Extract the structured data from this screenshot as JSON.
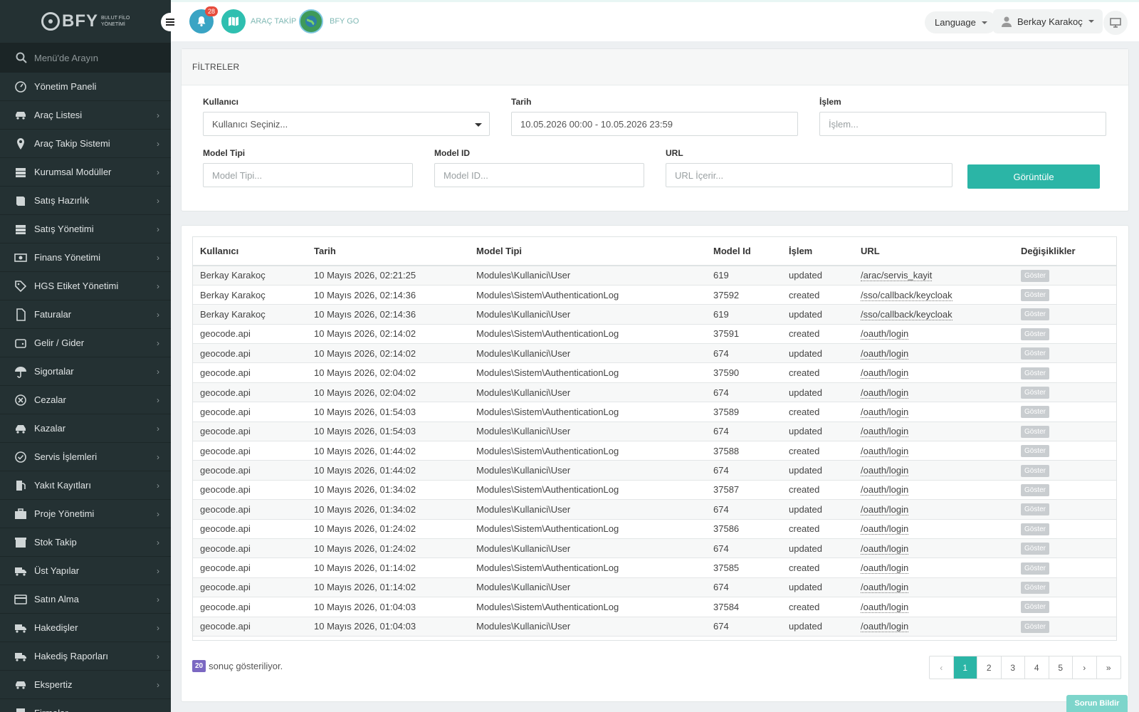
{
  "brand": {
    "name": "BFY",
    "sub1": "BULUT FİLO",
    "sub2": "YÖNETİMİ"
  },
  "sidebar": {
    "search_placeholder": "Menü'de Arayın",
    "items": [
      {
        "label": "Yönetim Paneli",
        "icon": "dashboard-icon",
        "chevron": false
      },
      {
        "label": "Araç Listesi",
        "icon": "car-icon",
        "chevron": true
      },
      {
        "label": "Araç Takip Sistemi",
        "icon": "map-pin-icon",
        "chevron": true
      },
      {
        "label": "Kurumsal Modüller",
        "icon": "server-icon",
        "chevron": true
      },
      {
        "label": "Satış Hazırlık",
        "icon": "book-icon",
        "chevron": true
      },
      {
        "label": "Satış Yönetimi",
        "icon": "server-icon",
        "chevron": true
      },
      {
        "label": "Finans Yönetimi",
        "icon": "money-icon",
        "chevron": true
      },
      {
        "label": "HGS Etiket Yönetimi",
        "icon": "tag-icon",
        "chevron": true
      },
      {
        "label": "Faturalar",
        "icon": "file-icon",
        "chevron": true
      },
      {
        "label": "Gelir / Gider",
        "icon": "wallet-icon",
        "chevron": true
      },
      {
        "label": "Sigortalar",
        "icon": "umbrella-icon",
        "chevron": true
      },
      {
        "label": "Cezalar",
        "icon": "cancel-circle-icon",
        "chevron": true
      },
      {
        "label": "Kazalar",
        "icon": "car-crash-icon",
        "chevron": true
      },
      {
        "label": "Servis İşlemleri",
        "icon": "check-circle-icon",
        "chevron": true
      },
      {
        "label": "Yakıt Kayıtları",
        "icon": "fuel-icon",
        "chevron": true
      },
      {
        "label": "Proje Yönetimi",
        "icon": "briefcase-icon",
        "chevron": true
      },
      {
        "label": "Stok Takip",
        "icon": "box-icon",
        "chevron": true
      },
      {
        "label": "Üst Yapılar",
        "icon": "truck-icon",
        "chevron": true
      },
      {
        "label": "Satın Alma",
        "icon": "credit-card-icon",
        "chevron": true
      },
      {
        "label": "Hakedişler",
        "icon": "truck-icon",
        "chevron": true
      },
      {
        "label": "Hakediş Raporları",
        "icon": "truck-icon",
        "chevron": true
      },
      {
        "label": "Ekspertiz",
        "icon": "car-icon",
        "chevron": true
      },
      {
        "label": "Firmalar",
        "icon": "building-icon",
        "chevron": true
      }
    ]
  },
  "topbar": {
    "notification_count": "28",
    "arac_takip": "ARAÇ TAKİP",
    "bfy_go": "BFY GO",
    "language": "Language",
    "user": "Berkay Karakoç"
  },
  "filters": {
    "title": "FİLTRELER",
    "user_label": "Kullanıcı",
    "user_value": "Kullanıcı Seçiniz...",
    "date_label": "Tarih",
    "date_value": "10.05.2026 00:00 - 10.05.2026 23:59",
    "action_label": "İşlem",
    "action_placeholder": "İşlem...",
    "model_type_label": "Model Tipi",
    "model_type_placeholder": "Model Tipi...",
    "model_id_label": "Model ID",
    "model_id_placeholder": "Model ID...",
    "url_label": "URL",
    "url_placeholder": "URL İçerir...",
    "submit": "Görüntüle"
  },
  "table": {
    "headers": [
      "Kullanıcı",
      "Tarih",
      "Model Tipi",
      "Model Id",
      "İşlem",
      "URL",
      "Değişiklikler"
    ],
    "button_label": "Göster",
    "rows": [
      [
        "Berkay Karakoç",
        "10 Mayıs 2026, 02:21:25",
        "Modules\\Kullanici\\User",
        "619",
        "updated",
        "/arac/servis_kayit"
      ],
      [
        "Berkay Karakoç",
        "10 Mayıs 2026, 02:14:36",
        "Modules\\Sistem\\AuthenticationLog",
        "37592",
        "created",
        "/sso/callback/keycloak"
      ],
      [
        "Berkay Karakoç",
        "10 Mayıs 2026, 02:14:36",
        "Modules\\Kullanici\\User",
        "619",
        "updated",
        "/sso/callback/keycloak"
      ],
      [
        "geocode.api",
        "10 Mayıs 2026, 02:14:02",
        "Modules\\Sistem\\AuthenticationLog",
        "37591",
        "created",
        "/oauth/login"
      ],
      [
        "geocode.api",
        "10 Mayıs 2026, 02:14:02",
        "Modules\\Kullanici\\User",
        "674",
        "updated",
        "/oauth/login"
      ],
      [
        "geocode.api",
        "10 Mayıs 2026, 02:04:02",
        "Modules\\Sistem\\AuthenticationLog",
        "37590",
        "created",
        "/oauth/login"
      ],
      [
        "geocode.api",
        "10 Mayıs 2026, 02:04:02",
        "Modules\\Kullanici\\User",
        "674",
        "updated",
        "/oauth/login"
      ],
      [
        "geocode.api",
        "10 Mayıs 2026, 01:54:03",
        "Modules\\Sistem\\AuthenticationLog",
        "37589",
        "created",
        "/oauth/login"
      ],
      [
        "geocode.api",
        "10 Mayıs 2026, 01:54:03",
        "Modules\\Kullanici\\User",
        "674",
        "updated",
        "/oauth/login"
      ],
      [
        "geocode.api",
        "10 Mayıs 2026, 01:44:02",
        "Modules\\Sistem\\AuthenticationLog",
        "37588",
        "created",
        "/oauth/login"
      ],
      [
        "geocode.api",
        "10 Mayıs 2026, 01:44:02",
        "Modules\\Kullanici\\User",
        "674",
        "updated",
        "/oauth/login"
      ],
      [
        "geocode.api",
        "10 Mayıs 2026, 01:34:02",
        "Modules\\Sistem\\AuthenticationLog",
        "37587",
        "created",
        "/oauth/login"
      ],
      [
        "geocode.api",
        "10 Mayıs 2026, 01:34:02",
        "Modules\\Kullanici\\User",
        "674",
        "updated",
        "/oauth/login"
      ],
      [
        "geocode.api",
        "10 Mayıs 2026, 01:24:02",
        "Modules\\Sistem\\AuthenticationLog",
        "37586",
        "created",
        "/oauth/login"
      ],
      [
        "geocode.api",
        "10 Mayıs 2026, 01:24:02",
        "Modules\\Kullanici\\User",
        "674",
        "updated",
        "/oauth/login"
      ],
      [
        "geocode.api",
        "10 Mayıs 2026, 01:14:02",
        "Modules\\Sistem\\AuthenticationLog",
        "37585",
        "created",
        "/oauth/login"
      ],
      [
        "geocode.api",
        "10 Mayıs 2026, 01:14:02",
        "Modules\\Kullanici\\User",
        "674",
        "updated",
        "/oauth/login"
      ],
      [
        "geocode.api",
        "10 Mayıs 2026, 01:04:03",
        "Modules\\Sistem\\AuthenticationLog",
        "37584",
        "created",
        "/oauth/login"
      ],
      [
        "geocode.api",
        "10 Mayıs 2026, 01:04:03",
        "Modules\\Kullanici\\User",
        "674",
        "updated",
        "/oauth/login"
      ]
    ]
  },
  "footer": {
    "count": "20",
    "count_text": "sonuç gösteriliyor.",
    "pages": [
      "‹",
      "1",
      "2",
      "3",
      "4",
      "5",
      "›",
      "»"
    ],
    "active_page": "1",
    "report_button": "Sorun Bildir"
  },
  "colors": {
    "accent": "#2bb5a6",
    "sidebar": "#243133",
    "badge": "#e74c3c",
    "count_badge": "#7b68c2"
  }
}
